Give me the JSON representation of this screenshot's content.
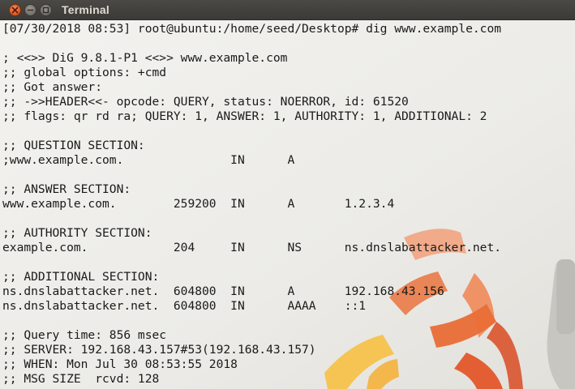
{
  "window": {
    "title": "Terminal"
  },
  "terminal": {
    "lines": [
      "[07/30/2018 08:53] root@ubuntu:/home/seed/Desktop# dig www.example.com",
      "",
      "; <<>> DiG 9.8.1-P1 <<>> www.example.com",
      ";; global options: +cmd",
      ";; Got answer:",
      ";; ->>HEADER<<- opcode: QUERY, status: NOERROR, id: 61520",
      ";; flags: qr rd ra; QUERY: 1, ANSWER: 1, AUTHORITY: 1, ADDITIONAL: 2",
      "",
      ";; QUESTION SECTION:",
      ";www.example.com.               IN      A",
      "",
      ";; ANSWER SECTION:",
      "www.example.com.        259200  IN      A       1.2.3.4",
      "",
      ";; AUTHORITY SECTION:",
      "example.com.            204     IN      NS      ns.dnslabattacker.net.",
      "",
      ";; ADDITIONAL SECTION:",
      "ns.dnslabattacker.net.  604800  IN      A       192.168.43.156",
      "ns.dnslabattacker.net.  604800  IN      AAAA    ::1",
      "",
      ";; Query time: 856 msec",
      ";; SERVER: 192.168.43.157#53(192.168.43.157)",
      ";; WHEN: Mon Jul 30 08:53:55 2018",
      ";; MSG SIZE  rcvd: 128"
    ]
  },
  "icons": {
    "close": "close-icon",
    "minimize": "minimize-icon",
    "maximize": "maximize-icon"
  },
  "colors": {
    "titlebar": "#3c3b37",
    "close_button": "#e8642f",
    "terminal_background": "#f1f0ed",
    "terminal_text": "#1a1a1a"
  }
}
